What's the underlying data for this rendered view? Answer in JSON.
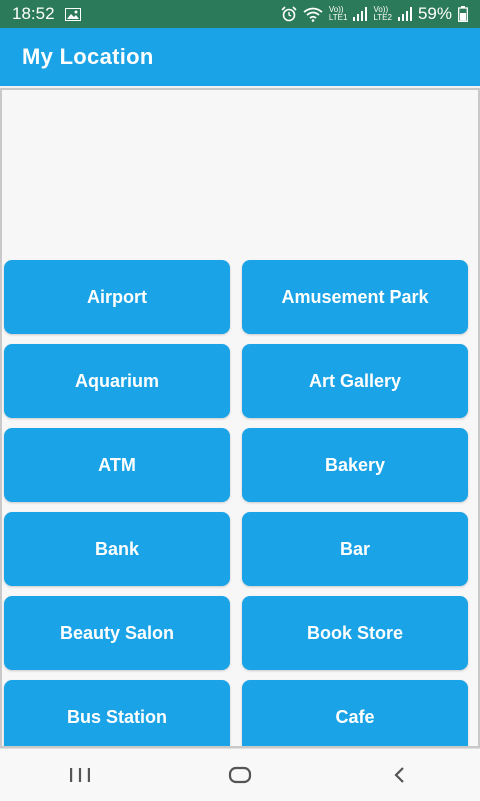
{
  "status_bar": {
    "time": "18:52",
    "battery": "59%",
    "icons": [
      "image-icon",
      "alarm-icon",
      "wifi-icon",
      "volte1-icon",
      "signal-icon",
      "volte2-icon",
      "signal-icon",
      "battery-icon"
    ],
    "lte1": "LTE1",
    "lte2": "LTE2",
    "vo1": "Vo))",
    "vo2": "Vo))"
  },
  "app_bar": {
    "title": "My Location"
  },
  "places": [
    "Airport",
    "Amusement Park",
    "Aquarium",
    "Art Gallery",
    "ATM",
    "Bakery",
    "Bank",
    "Bar",
    "Beauty Salon",
    "Book Store",
    "Bus Station",
    "Cafe"
  ],
  "colors": {
    "accent": "#1aa3e6",
    "status_bar": "#2b7a5a"
  },
  "nav_bar": {
    "icons": [
      "recent-apps-icon",
      "home-icon",
      "back-icon"
    ]
  }
}
